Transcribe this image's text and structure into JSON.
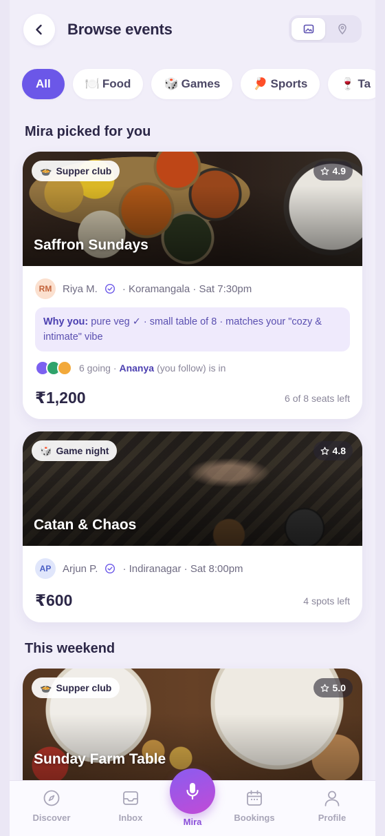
{
  "header": {
    "title": "Browse events",
    "back_icon": "chevron-left-icon",
    "view_toggle": [
      {
        "name": "image-view-icon",
        "active": true
      },
      {
        "name": "map-pin-icon",
        "active": false
      }
    ]
  },
  "chips": [
    {
      "label": "All",
      "icon": "",
      "active": true
    },
    {
      "label": "Food",
      "icon": "🍽️",
      "active": false
    },
    {
      "label": "Games",
      "icon": "🎲",
      "active": false
    },
    {
      "label": "Sports",
      "icon": "🏓",
      "active": false
    },
    {
      "label": "Ta",
      "icon": "🍷",
      "active": false
    }
  ],
  "sections": {
    "picked": "Mira picked for you",
    "weekend": "This weekend"
  },
  "cards": [
    {
      "tag": "Supper club",
      "tag_icon": "🍲",
      "rating": "4.9",
      "title": "Saffron Sundays",
      "host_initials": "RM",
      "host": "Riya M.",
      "meta": "· Koramangala · Sat 7:30pm",
      "why_label": "Why you:",
      "why_text": " pure veg ✓ · small table of 8 · matches your \"cozy & intimate\" vibe",
      "going": "6 going ·",
      "friend": "Ananya",
      "friend_suffix": "(you follow) is in",
      "price": "₹1,200",
      "availability": "6 of 8 seats left"
    },
    {
      "tag": "Game night",
      "tag_icon": "🎲",
      "rating": "4.8",
      "title": "Catan & Chaos",
      "host_initials": "AP",
      "host": "Arjun P.",
      "meta": "· Indiranagar · Sat 8:00pm",
      "price": "₹600",
      "availability": "4 spots left"
    },
    {
      "tag": "Supper club",
      "tag_icon": "🍲",
      "rating": "5.0",
      "title": "Sunday Farm Table"
    }
  ],
  "going_colors": [
    "#7b61f0",
    "#2fa36b",
    "#f2a93b"
  ],
  "nav": {
    "discover": "Discover",
    "inbox": "Inbox",
    "mira": "Mira",
    "bookings": "Bookings",
    "profile": "Profile"
  },
  "colors": {
    "accent": "#6b57e8",
    "mira_gradient_start": "#8a5cf0",
    "mira_gradient_end": "#c14bd6"
  }
}
